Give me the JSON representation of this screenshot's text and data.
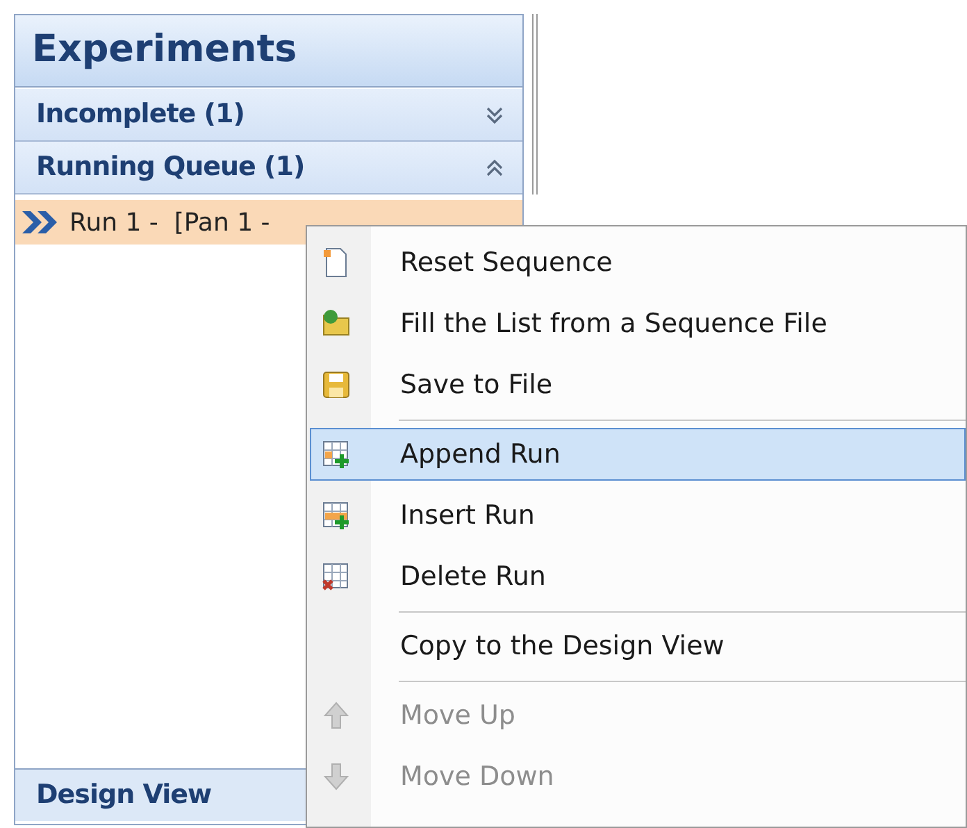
{
  "panel": {
    "title": "Experiments",
    "sections": [
      {
        "label": "Incomplete (1)",
        "expanded": false
      },
      {
        "label": "Running Queue (1)",
        "expanded": true
      }
    ],
    "runs": [
      {
        "label": "Run 1 -  [Pan 1 -",
        "selected": true
      }
    ],
    "bottom_section": {
      "label": "Design View"
    }
  },
  "context_menu": [
    {
      "kind": "item",
      "label": "Reset Sequence",
      "selected": false,
      "disabled": false
    },
    {
      "kind": "item",
      "label": "Fill the List from a Sequence File",
      "selected": false,
      "disabled": false
    },
    {
      "kind": "item",
      "label": "Save to File",
      "selected": false,
      "disabled": false
    },
    {
      "kind": "separator"
    },
    {
      "kind": "item",
      "label": "Append Run",
      "selected": true,
      "disabled": false
    },
    {
      "kind": "item",
      "label": "Insert Run",
      "selected": false,
      "disabled": false
    },
    {
      "kind": "item",
      "label": "Delete Run",
      "selected": false,
      "disabled": false
    },
    {
      "kind": "separator"
    },
    {
      "kind": "item",
      "label": "Copy to the Design View",
      "selected": false,
      "disabled": false
    },
    {
      "kind": "separator"
    },
    {
      "kind": "item",
      "label": "Move Up",
      "selected": false,
      "disabled": true
    },
    {
      "kind": "item",
      "label": "Move Down",
      "selected": false,
      "disabled": true
    }
  ]
}
